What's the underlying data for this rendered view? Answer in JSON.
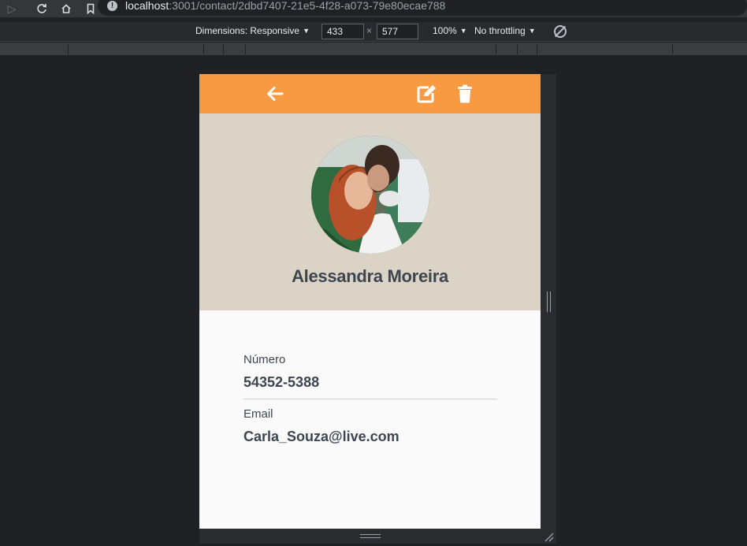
{
  "browser": {
    "url_host": "localhost",
    "url_path": ":3001/contact/2dbd7407-21e5-4f28-a073-79e80ecae788",
    "icons": [
      "forward-icon",
      "reload-icon",
      "home-icon",
      "bookmark-icon",
      "site-info-icon"
    ]
  },
  "device_toolbar": {
    "dimensions_label": "Dimensions: Responsive",
    "width": "433",
    "separator": "×",
    "height": "577",
    "zoom": "100%",
    "throttling": "No throttling",
    "rotate_icon": "rotate-icon"
  },
  "app": {
    "header_color": "#f89a42",
    "header_icons": [
      "back-arrow-icon",
      "edit-icon",
      "trash-icon"
    ],
    "contact": {
      "name": "Alessandra Moreira",
      "number_label": "Número",
      "number_value": "54352-5388",
      "email_label": "Email",
      "email_value": "Carla_Souza@live.com"
    }
  }
}
